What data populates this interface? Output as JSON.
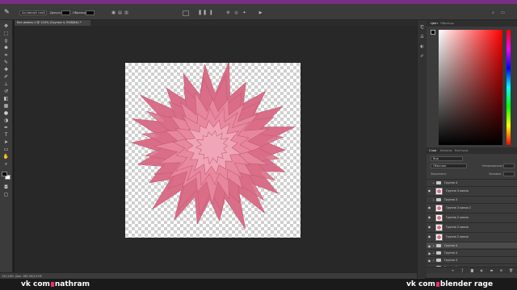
{
  "app": {
    "title_color": "#7a2f86",
    "doc_tab": "Без имени-1 @ 120% (Группа 4, RGB/8#) *"
  },
  "options_bar": {
    "tool_icon": "eyedropper-icon",
    "sample_label": "Активный слой",
    "tolerance_label": "Допуск:",
    "tolerance_value": "",
    "sample_all_label": "Образец:",
    "swatch_color": "#000000"
  },
  "toolbox": {
    "icons": [
      "move-icon",
      "marquee-icon",
      "lasso-icon",
      "quick-select-icon",
      "crop-icon",
      "eyedropper-icon",
      "healing-icon",
      "brush-icon",
      "stamp-icon",
      "history-brush-icon",
      "eraser-icon",
      "gradient-icon",
      "blur-icon",
      "dodge-icon",
      "pen-icon",
      "type-icon",
      "path-select-icon",
      "shape-icon",
      "hand-icon",
      "zoom-icon"
    ],
    "foreground": "#000000",
    "background": "#ffffff"
  },
  "canvas": {
    "flower_color": "#d96e88",
    "flower_inner": "#e88aa0",
    "flower_center": "#f0a6b8"
  },
  "status": {
    "zoom": "120,18%",
    "doc_size": "Док: 165,9K/3,91M"
  },
  "color_panel": {
    "tabs": [
      "Цвет",
      "Образцы"
    ],
    "hue": "#ff0000"
  },
  "layers_panel": {
    "tabs": [
      "Слои",
      "Каналы",
      "Контуры"
    ],
    "kind": "Вид",
    "blend_mode": "Обычные",
    "opacity_label": "Непрозрачность:",
    "opacity_value": "",
    "lock_label": "Закрепить:",
    "fill_label": "Заливка:",
    "fill_value": "",
    "layers": [
      {
        "name": "Группа 4",
        "type": "group",
        "visible": false,
        "selected": false
      },
      {
        "name": "Группа 3 копия",
        "type": "layer",
        "visible": true,
        "selected": false
      },
      {
        "name": "Группа 3",
        "type": "group",
        "visible": false,
        "selected": false
      },
      {
        "name": "Группа 3 копия 2",
        "type": "layer",
        "visible": true,
        "selected": false
      },
      {
        "name": "Группа 2 копия",
        "type": "layer",
        "visible": true,
        "selected": false
      },
      {
        "name": "Группа 2 копия",
        "type": "layer",
        "visible": true,
        "selected": false
      },
      {
        "name": "Группа 2 копия",
        "type": "layer",
        "visible": true,
        "selected": false
      },
      {
        "name": "Группа 4",
        "type": "group",
        "visible": true,
        "selected": true
      },
      {
        "name": "Группа 4",
        "type": "group",
        "visible": true,
        "selected": false
      },
      {
        "name": "Группа 3",
        "type": "group",
        "visible": true,
        "selected": false
      },
      {
        "name": "Группа 1",
        "type": "group",
        "visible": true,
        "selected": false
      }
    ]
  },
  "watermark": {
    "left_a": "vk com",
    "left_b": "nathram",
    "right_a": "vk com",
    "right_b": "blender rage",
    "dot_color": "#e8306a"
  }
}
